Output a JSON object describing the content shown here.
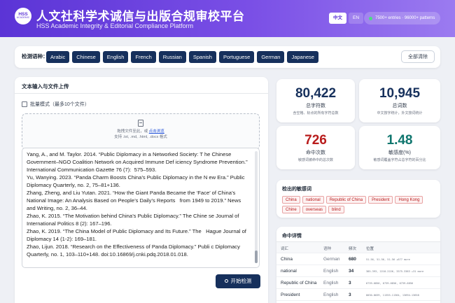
{
  "header": {
    "logo_text": "HSS",
    "logo_sub": "ACADEMIC",
    "title_cn": "人文社科学术诚信与出版合规审校平台",
    "title_en": "HSS Academic Integrity & Editorial Compliance Platform",
    "lang_cn": "中文",
    "lang_en": "EN",
    "stats_pill": "7500+ entries · 96000+ patterns"
  },
  "language_bar": {
    "label": "检测语种：",
    "languages": [
      "Arabic",
      "Chinese",
      "English",
      "French",
      "Russian",
      "Spanish",
      "Portuguese",
      "German",
      "Japanese"
    ],
    "clear_label": "全部清除"
  },
  "input_panel": {
    "title": "文本输入与文件上传",
    "batch_label": "批量模式（最多10个文件）",
    "drop_text": "拖拽文件至此，或",
    "drop_link": "点击浏览",
    "drop_formats": "支持 .txt, .md, .html, .docx 格式",
    "text": "Yang, A., and M. Taylor. 2014. “Public Diplomacy in a Networked Society: T he Chinese Government–NGO Coalition Network on Acquired Immune Def iciency Syndrome Prevention.” International Communication Gazette 76 (7):  575–593.\nYu, Wanying. 2023. “Panda Charm Boosts China’s Public Diplomacy in the N ew Era.” Public Diplomacy Quarterly, no. 2, 75–81+136.\nZhang, Zheng, and Liu Yutan. 2021. “How the Giant Panda Became the ‘Face’ of China’s National Image: An Analysis Based on People’s Daily’s Reports   from 1949 to 2019.” News and Writing, no. 2, 36–44.\nZhao, K. 2015. “The Motivation behind China’s Public Diplomacy.” The Chine se Journal of International Politics 8 (2): 167–196.\nZhao, K. 2019. “The China Model of Public Diplomacy and Its Future.” The   Hague Journal of Diplomacy 14 (1-2): 169–181.\nZhao, Lijun. 2018. “Research on the Effectiveness of Panda Diplomacy.” Publi c Diplomacy Quarterly, no. 1, 103–110+148. doi:10.16869/j.cnki.pdq.2018.01.018.",
    "detect_label": "开始检测"
  },
  "stats": [
    {
      "value": "80,422",
      "label": "总字符数",
      "sub": "含空格、标点的所有字符总数"
    },
    {
      "value": "10,945",
      "label": "总词数",
      "sub": "中文按字统计，外文按词统计"
    },
    {
      "value": "726",
      "label": "命中次数",
      "sub": "敏感词被命中的总次数"
    },
    {
      "value": "1.48",
      "label": "敏感度(%)",
      "sub": "敏感词覆盖字符占总字符的百分比"
    }
  ],
  "detected_words": {
    "title": "检出的敏感词",
    "tags": [
      "China",
      "national",
      "Republic of China",
      "President",
      "Hong Kong",
      "Chine",
      "overseas",
      "blind"
    ]
  },
  "hit_details": {
    "title": "命中详情",
    "columns": [
      "词汇",
      "语种",
      "频次",
      "位置"
    ],
    "rows": [
      {
        "word": "China",
        "lang": "German",
        "count": "680",
        "pos": "51-56, 51-56, 51-56 +677 more"
      },
      {
        "word": "national",
        "lang": "English",
        "count": "34",
        "pos": "385-393, 2218-2226, 3375-3383 +31 more"
      },
      {
        "word": "Republic of China",
        "lang": "English",
        "count": "3",
        "pos": "6739-6856, 6739-6856, 6739-6856"
      },
      {
        "word": "President",
        "lang": "English",
        "count": "3",
        "pos": "8030-8039, 11355-11364, 13694-13658"
      }
    ]
  }
}
